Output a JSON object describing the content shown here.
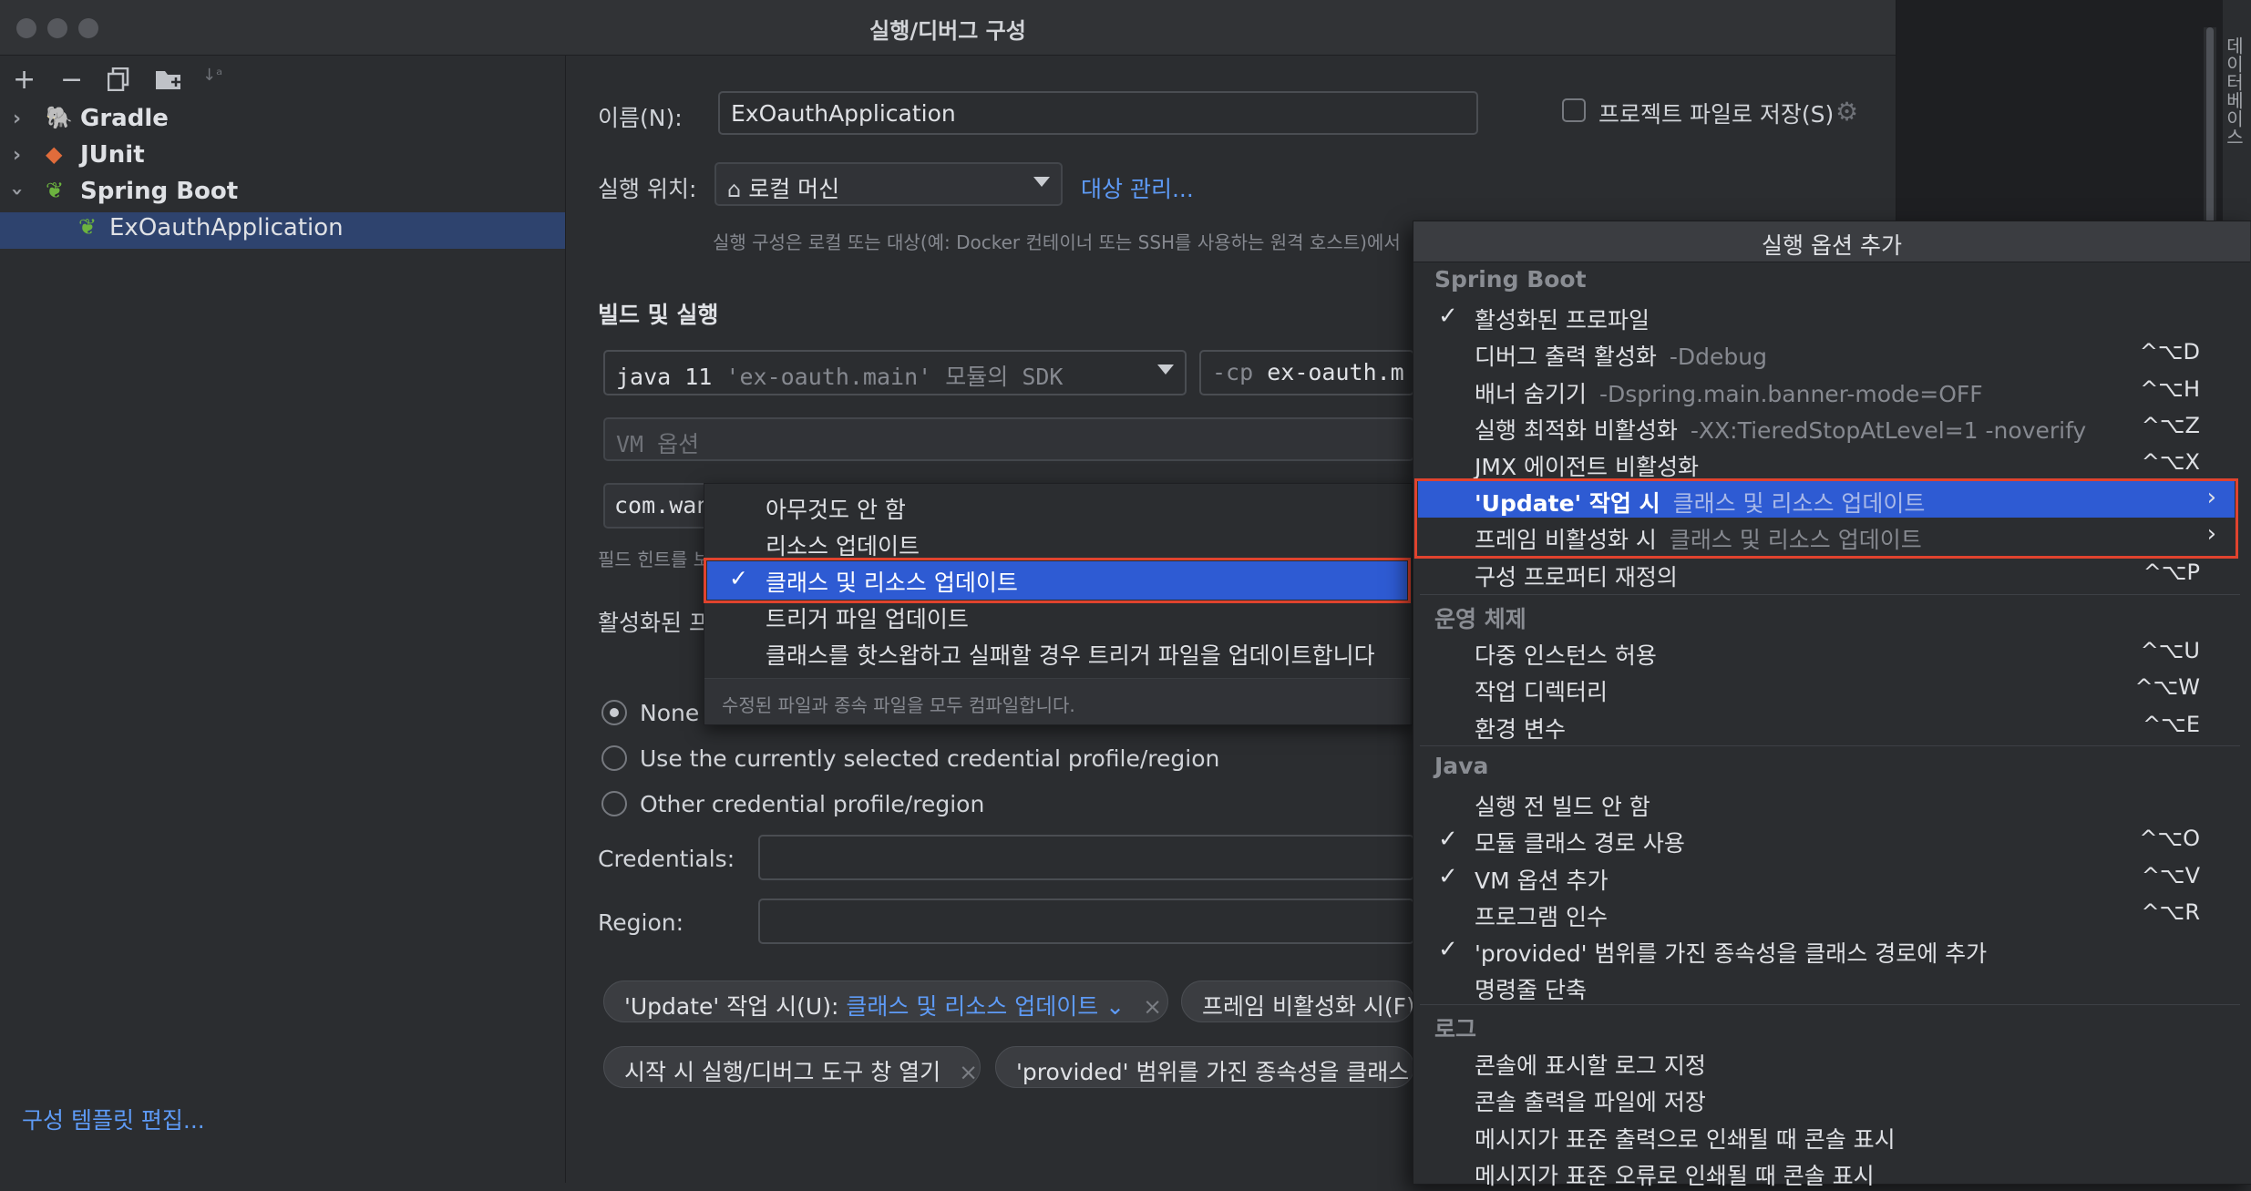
{
  "dialog": {
    "title": "실행/디버그 구성"
  },
  "tree": {
    "items": [
      {
        "label": "Gradle",
        "expanded": false
      },
      {
        "label": "JUnit",
        "expanded": false
      },
      {
        "label": "Spring Boot",
        "expanded": true
      },
      {
        "label": "ExOauthApplication",
        "selected": true
      }
    ],
    "edit_templates": "구성 템플릿 편집..."
  },
  "form": {
    "name_label": "이름(N):",
    "name_value": "ExOauthApplication",
    "store_label": "프로젝트 파일로 저장(S)",
    "run_on_label": "실행 위치:",
    "run_on_value": "로컬 머신",
    "manage_targets": "대상 관리...",
    "run_on_hint": "실행 구성은 로컬 또는 대상(예: Docker 컨테이너 또는 SSH를 사용하는 원격 호스트)에서",
    "build_run_title": "빌드 및 실행",
    "sdk_prefix": "java 11",
    "sdk_module": "'ex-oauth.main'",
    "sdk_suffix": "모듈의 SDK",
    "cp_prefix": "-cp",
    "cp_value": "ex-oauth.m",
    "vm_placeholder": "VM 옵션",
    "main_class": "com.wan",
    "field_hint": "필드 힌트를 보",
    "active_profiles_label": "활성화된 프",
    "radio_none": "None",
    "radio_current": "Use the currently selected credential profile/region",
    "radio_other": "Other credential profile/region",
    "credentials_label": "Credentials:",
    "region_label": "Region:"
  },
  "chips": [
    {
      "label": "'Update' 작업 시(U):",
      "value": "클래스 및 리소스 업데이트"
    },
    {
      "label": "프레임 비활성화 시(F):",
      "value": ""
    },
    {
      "label": "시작 시 실행/디버그 도구 창 열기",
      "value": ""
    },
    {
      "label": "'provided' 범위를 가진 종속성을 클래스 경",
      "value": ""
    }
  ],
  "update_popup": {
    "items": [
      "아무것도 안 함",
      "리소스 업데이트",
      "클래스 및 리소스 업데이트",
      "트리거 파일 업데이트",
      "클래스를 핫스왑하고 실패할 경우 트리거 파일을 업데이트합니다"
    ],
    "selected_index": 2,
    "footer": "수정된 파일과 종속 파일을 모두 컴파일합니다."
  },
  "options_popup": {
    "title": "실행 옵션 추가",
    "sections": [
      {
        "name": "Spring Boot",
        "items": [
          {
            "label": "활성화된 프로파일",
            "sub": "",
            "shortcut": "",
            "checked": true,
            "submenu": false
          },
          {
            "label": "디버그 출력 활성화",
            "sub": "-Ddebug",
            "shortcut": "^⌥D",
            "checked": false,
            "submenu": false
          },
          {
            "label": "배너 숨기기",
            "sub": "-Dspring.main.banner-mode=OFF",
            "shortcut": "^⌥H",
            "checked": false,
            "submenu": false
          },
          {
            "label": "실행 최적화 비활성화",
            "sub": "-XX:TieredStopAtLevel=1 -noverify",
            "shortcut": "^⌥Z",
            "checked": false,
            "submenu": false
          },
          {
            "label": "JMX 에이전트 비활성화",
            "sub": "",
            "shortcut": "^⌥X",
            "checked": false,
            "submenu": false
          },
          {
            "label": "'Update' 작업 시",
            "sub": "클래스 및 리소스 업데이트",
            "shortcut": "",
            "checked": false,
            "submenu": true
          },
          {
            "label": "프레임 비활성화 시",
            "sub": "클래스 및 리소스 업데이트",
            "shortcut": "",
            "checked": false,
            "submenu": true
          },
          {
            "label": "구성 프로퍼티 재정의",
            "sub": "",
            "shortcut": "^⌥P",
            "checked": false,
            "submenu": false
          }
        ]
      },
      {
        "name": "운영 체제",
        "items": [
          {
            "label": "다중 인스턴스 허용",
            "sub": "",
            "shortcut": "^⌥U",
            "checked": false,
            "submenu": false
          },
          {
            "label": "작업 디렉터리",
            "sub": "",
            "shortcut": "^⌥W",
            "checked": false,
            "submenu": false
          },
          {
            "label": "환경 변수",
            "sub": "",
            "shortcut": "^⌥E",
            "checked": false,
            "submenu": false
          }
        ]
      },
      {
        "name": "Java",
        "items": [
          {
            "label": "실행 전 빌드 안 함",
            "sub": "",
            "shortcut": "",
            "checked": false,
            "submenu": false
          },
          {
            "label": "모듈 클래스 경로 사용",
            "sub": "",
            "shortcut": "^⌥O",
            "checked": true,
            "submenu": false
          },
          {
            "label": "VM 옵션 추가",
            "sub": "",
            "shortcut": "^⌥V",
            "checked": true,
            "submenu": false
          },
          {
            "label": "프로그램 인수",
            "sub": "",
            "shortcut": "^⌥R",
            "checked": false,
            "submenu": false
          },
          {
            "label": "'provided' 범위를 가진 종속성을 클래스 경로에 추가",
            "sub": "",
            "shortcut": "",
            "checked": true,
            "submenu": false
          },
          {
            "label": "명령줄 단축",
            "sub": "",
            "shortcut": "",
            "checked": false,
            "submenu": false
          }
        ]
      },
      {
        "name": "로그",
        "items": [
          {
            "label": "콘솔에 표시할 로그 지정",
            "sub": "",
            "shortcut": "",
            "checked": false,
            "submenu": false
          },
          {
            "label": "콘솔 출력을 파일에 저장",
            "sub": "",
            "shortcut": "",
            "checked": false,
            "submenu": false
          },
          {
            "label": "메시지가 표준 출력으로 인쇄될 때 콘솔 표시",
            "sub": "",
            "shortcut": "",
            "checked": false,
            "submenu": false
          },
          {
            "label": "메시지가 표준 오류로 인쇄될 때 콘솔 표시",
            "sub": "",
            "shortcut": "",
            "checked": false,
            "submenu": false
          }
        ]
      }
    ]
  },
  "ide": {
    "side_label": "데이터베이스"
  },
  "colors": {
    "accent": "#2e5bd3",
    "link": "#5e9bf7",
    "highlight_border": "#e0432e",
    "background": "#2b2d30"
  }
}
